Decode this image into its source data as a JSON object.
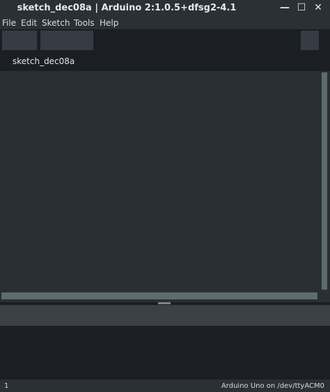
{
  "window": {
    "title": "sketch_dec08a | Arduino 2:1.0.5+dfsg2-4.1",
    "controls": {
      "minimize": "—",
      "maximize": "☐",
      "close": "✕"
    }
  },
  "menu": {
    "items": [
      "File",
      "Edit",
      "Sketch",
      "Tools",
      "Help"
    ]
  },
  "tabs": [
    {
      "label": "sketch_dec08a"
    }
  ],
  "footer": {
    "line_number": "1",
    "board": "Arduino Uno on /dev/ttyACM0"
  },
  "colors": {
    "editor_bg": "#2a2f36",
    "toolbar_bg": "#1b1f24",
    "scroll_thumb": "#5e6c6b"
  }
}
